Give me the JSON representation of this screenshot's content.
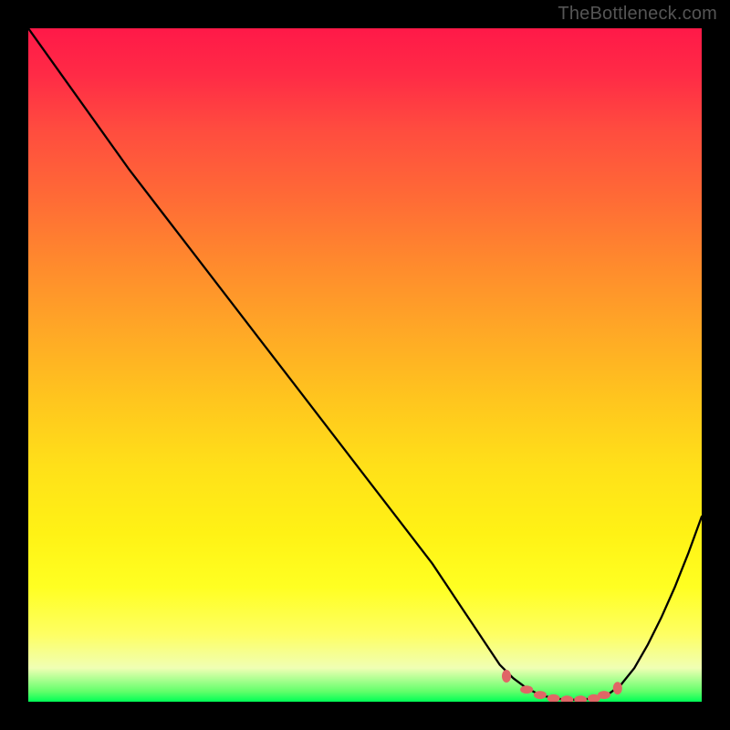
{
  "watermark": "TheBottleneck.com",
  "chart_data": {
    "type": "line",
    "title": "",
    "xlabel": "",
    "ylabel": "",
    "xlim": [
      0,
      100
    ],
    "ylim": [
      0,
      100
    ],
    "series": [
      {
        "name": "bottleneck-curve",
        "x": [
          0,
          5,
          10,
          15,
          20,
          25,
          30,
          35,
          40,
          45,
          50,
          55,
          60,
          62,
          64,
          66,
          68,
          70,
          72,
          74,
          76,
          78,
          80,
          82,
          84,
          86,
          88,
          90,
          92,
          94,
          96,
          98,
          100
        ],
        "y": [
          100,
          93,
          86,
          79,
          72.5,
          66,
          59.5,
          53,
          46.5,
          40,
          33.5,
          27,
          20.5,
          17.5,
          14.5,
          11.5,
          8.5,
          5.5,
          3.5,
          2,
          1,
          0.5,
          0.3,
          0.3,
          0.5,
          1,
          2.5,
          5,
          8.5,
          12.5,
          17,
          22,
          27.5
        ]
      }
    ],
    "markers": {
      "name": "optimal-range",
      "color": "#e06666",
      "x": [
        71,
        74,
        76,
        78,
        80,
        82,
        84,
        85.5,
        87.5
      ],
      "y": [
        3.8,
        1.8,
        1,
        0.5,
        0.3,
        0.3,
        0.5,
        1,
        2
      ]
    },
    "background": {
      "type": "vertical-gradient",
      "stops": [
        {
          "pos": 0,
          "color": "#ff1948"
        },
        {
          "pos": 50,
          "color": "#ffc51e"
        },
        {
          "pos": 85,
          "color": "#ffff30"
        },
        {
          "pos": 100,
          "color": "#00ff56"
        }
      ]
    }
  }
}
